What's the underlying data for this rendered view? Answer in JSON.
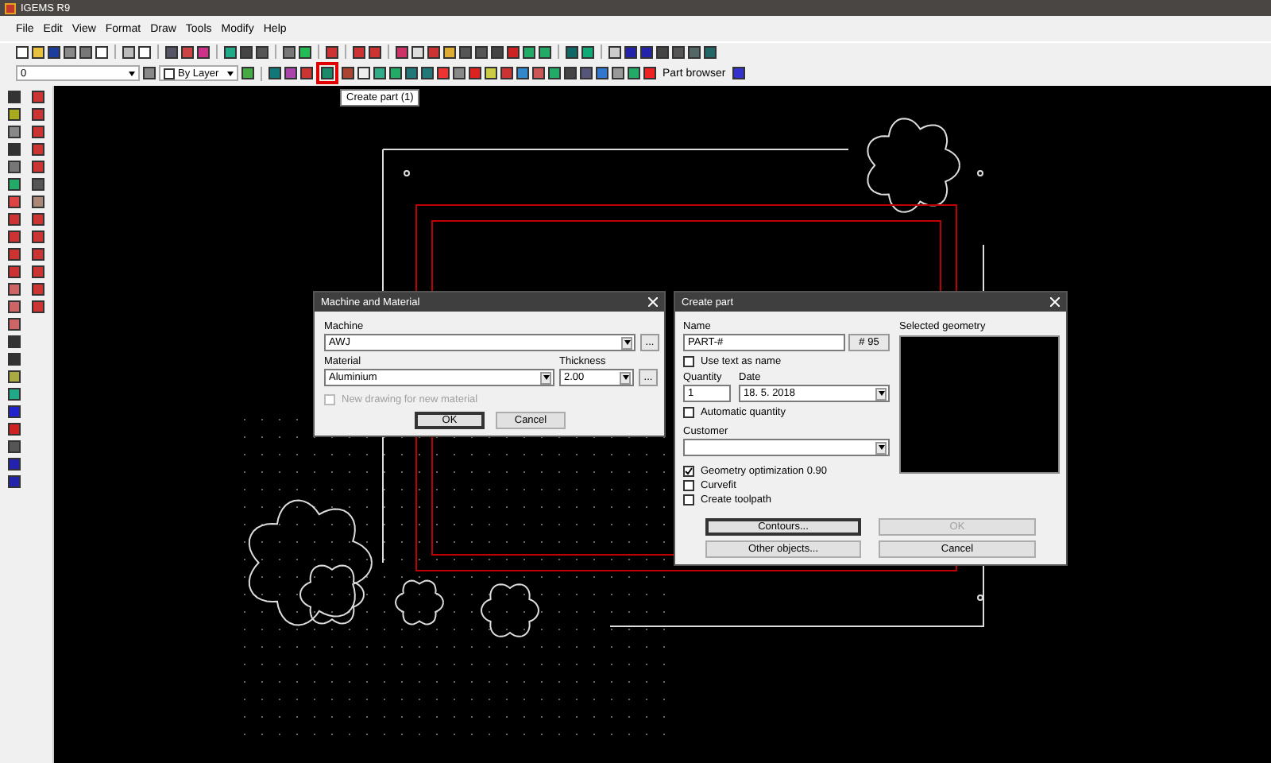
{
  "window": {
    "title": "IGEMS R9"
  },
  "menu": [
    "File",
    "Edit",
    "View",
    "Format",
    "Draw",
    "Tools",
    "Modify",
    "Help"
  ],
  "toolbar": {
    "layer": "0",
    "linetype": "By Layer",
    "part_browser": "Part browser",
    "highlighted_tool": {
      "tooltip": "Create part (1)"
    }
  },
  "machine_dialog": {
    "title": "Machine and Material",
    "machine_label": "Machine",
    "machine": "AWJ",
    "browse": "...",
    "material_label": "Material",
    "material": "Aluminium",
    "thickness_label": "Thickness",
    "thickness": "2.00",
    "thickness_browse": "...",
    "checkbox": {
      "label": "New drawing for new material",
      "checked": false,
      "disabled": true
    },
    "buttons": [
      {
        "label": "OK",
        "focused": true,
        "disabled": false
      },
      {
        "label": "Cancel",
        "focused": false,
        "disabled": false
      }
    ]
  },
  "create_part_dialog": {
    "title": "Create part",
    "name_label": "Name",
    "name": "PART-#",
    "number_button": "# 95",
    "quantity_label": "Quantity",
    "quantity": "1",
    "date_label": "Date",
    "date": "18. 5. 2018",
    "customer_label": "Customer",
    "geometry_label": "Selected geometry",
    "checkboxes": [
      {
        "label": "Use text as name",
        "checked": false
      },
      {
        "label": "Automatic quantity",
        "checked": false
      },
      {
        "label": "Geometry optimization 0.90",
        "checked": true
      },
      {
        "label": "Curvefit",
        "checked": false
      },
      {
        "label": "Create toolpath",
        "checked": false
      }
    ],
    "buttons": [
      {
        "label": "Contours...",
        "focused": true,
        "disabled": false
      },
      {
        "label": "OK",
        "focused": false,
        "disabled": true
      },
      {
        "label": "Other objects...",
        "focused": false,
        "disabled": false
      },
      {
        "label": "Cancel",
        "focused": false,
        "disabled": false
      }
    ]
  }
}
